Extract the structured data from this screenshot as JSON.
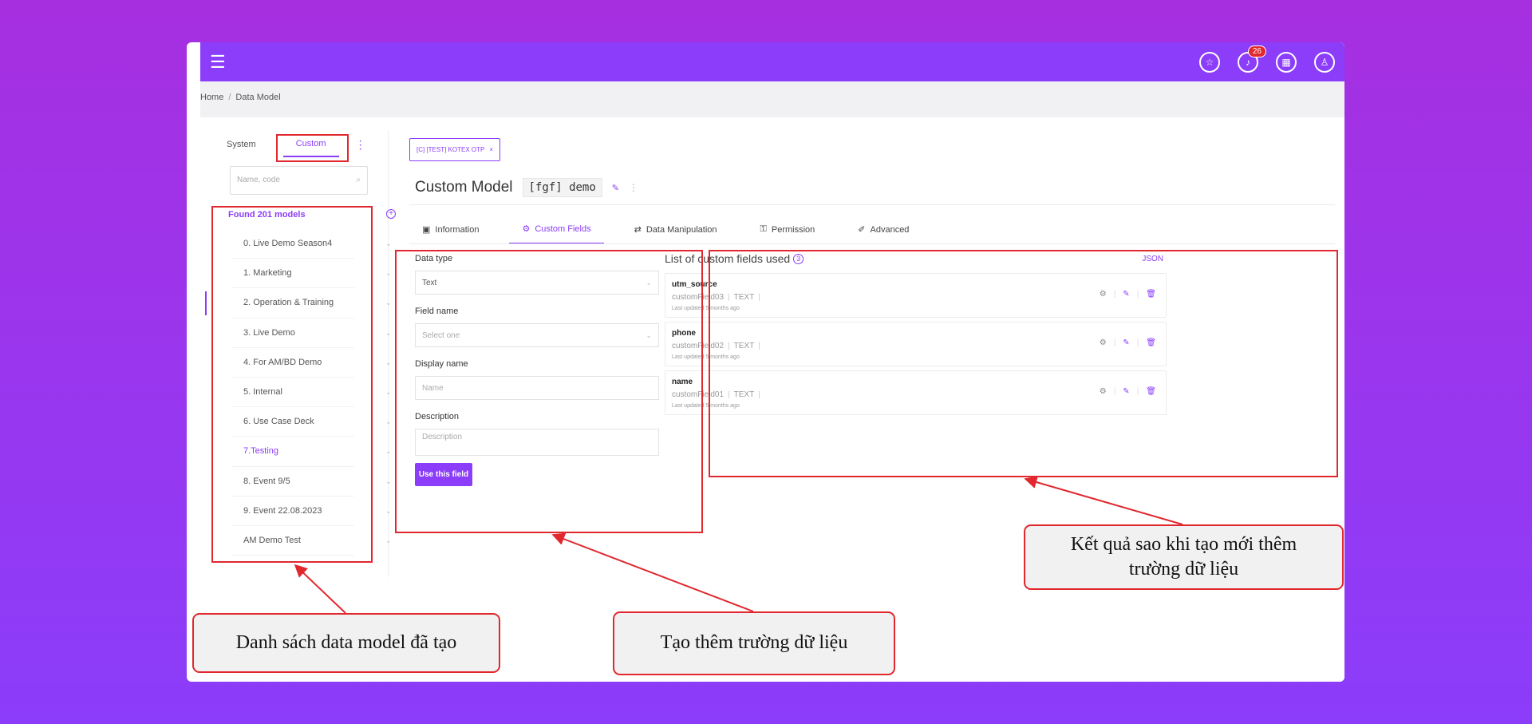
{
  "topbar": {
    "notification_count": "26"
  },
  "breadcrumb": {
    "home": "Home",
    "separator": "/",
    "current": "Data Model"
  },
  "left_tabs": {
    "system": "System",
    "custom": "Custom"
  },
  "search": {
    "placeholder": "Name, code"
  },
  "found_label": "Found 201 models",
  "models": [
    "0. Live Demo Season4",
    "1. Marketing",
    "2. Operation & Training",
    "3. Live Demo",
    "4. For AM/BD Demo",
    "5. Internal",
    "6. Use Case Deck",
    "7.Testing",
    "8. Event 9/5",
    "9. Event 22.08.2023",
    "AM Demo Test"
  ],
  "open_tab": {
    "label": "[C] [TEST] KOTEX OTP",
    "close": "×"
  },
  "model_title": "Custom Model",
  "model_code": "[fgf] demo",
  "content_tabs": {
    "information": "Information",
    "custom_fields": "Custom Fields",
    "data_manipulation": "Data Manipulation",
    "permission": "Permission",
    "advanced": "Advanced"
  },
  "form": {
    "data_type_label": "Data type",
    "data_type_value": "Text",
    "field_name_label": "Field name",
    "field_name_placeholder": "Select one",
    "display_name_label": "Display name",
    "display_name_placeholder": "Name",
    "description_label": "Description",
    "description_placeholder": "Description",
    "submit": "Use this field"
  },
  "fields_list": {
    "title": "List of custom fields used",
    "count": "3",
    "json": "JSON",
    "items": [
      {
        "name": "utm_source",
        "code": "customField03",
        "type": "TEXT",
        "updated": "Last updated 5 months ago"
      },
      {
        "name": "phone",
        "code": "customField02",
        "type": "TEXT",
        "updated": "Last updated 5 months ago"
      },
      {
        "name": "name",
        "code": "customField01",
        "type": "TEXT",
        "updated": "Last updated 5 months ago"
      }
    ]
  },
  "callouts": {
    "model_list": "Danh sách data model đã tạo",
    "add_field": "Tạo thêm trường dữ liệu",
    "result": "Kết quả sao khi tạo mới thêm trường dữ liệu"
  },
  "colors": {
    "brand": "#8b3dfa",
    "annotation_red": "#e0282e"
  },
  "icons": [
    "menu-icon",
    "support-icon",
    "bell-icon",
    "apps-icon",
    "user-icon",
    "search-icon",
    "add-circle-icon",
    "pin-icon",
    "more-icon",
    "info-icon",
    "gear-icon",
    "swap-icon",
    "key-icon",
    "wrench-icon",
    "chevron-down-icon",
    "edit-icon",
    "trash-icon"
  ]
}
